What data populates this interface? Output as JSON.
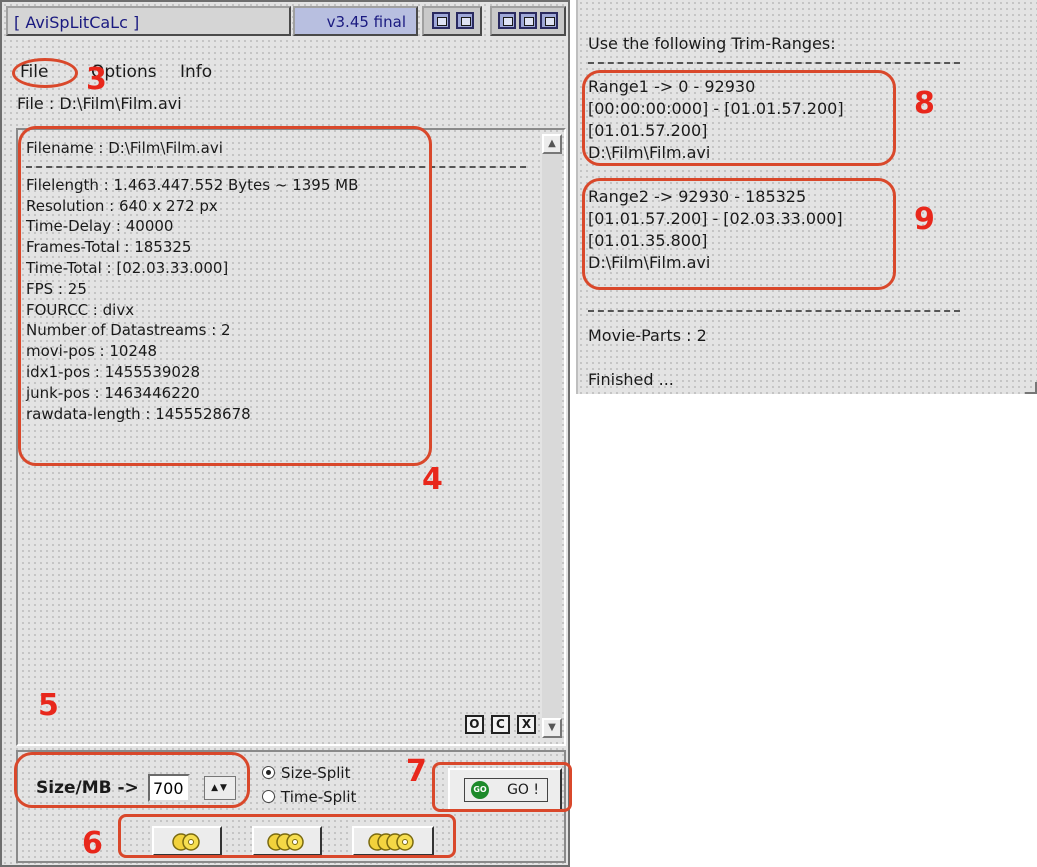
{
  "window": {
    "title": "[ AviSpLitCaLc ]",
    "version": "v3.45 final",
    "menu": [
      "File",
      "Options",
      "Info"
    ],
    "file_line": "File :  D:\\Film\\Film.avi"
  },
  "info_panel": {
    "filename": "Filename : D:\\Film\\Film.avi",
    "lines": [
      "Filelength : 1.463.447.552 Bytes   ~ 1395 MB",
      "Resolution : 640 x 272 px",
      "Time-Delay : 40000",
      "Frames-Total : 185325",
      "Time-Total : [02.03.33.000]",
      "FPS : 25",
      "FOURCC : divx",
      "Number of Datastreams : 2",
      "movi-pos : 10248",
      "idx1-pos : 1455539028",
      "junk-pos : 1463446220",
      "rawdata-length : 1455528678"
    ],
    "buttons": [
      "O",
      "C",
      "X"
    ]
  },
  "bottom": {
    "size_label": "Size/MB ->",
    "size_value": "700",
    "radio_size": "Size-Split",
    "radio_time": "Time-Split",
    "go_label": "GO !",
    "go_icon": "GO"
  },
  "log": {
    "header": "Use the following Trim-Ranges:",
    "range1": [
      "Range1 -> 0 - 92930",
      "[00:00:00:000] - [01.01.57.200]",
      "[01.01.57.200]",
      "D:\\Film\\Film.avi"
    ],
    "range2": [
      "Range2 -> 92930 - 185325",
      "[01.01.57.200] - [02.03.33.000]",
      "[01.01.35.800]",
      "D:\\Film\\Film.avi"
    ],
    "parts": "Movie-Parts : 2",
    "finished": "Finished ..."
  },
  "annotations": [
    "3",
    "4",
    "5",
    "6",
    "7",
    "8",
    "9"
  ],
  "colors": {
    "annotation": "#e8271b",
    "title_text": "#1a1a80",
    "go_icon": "#1d8a2a"
  }
}
